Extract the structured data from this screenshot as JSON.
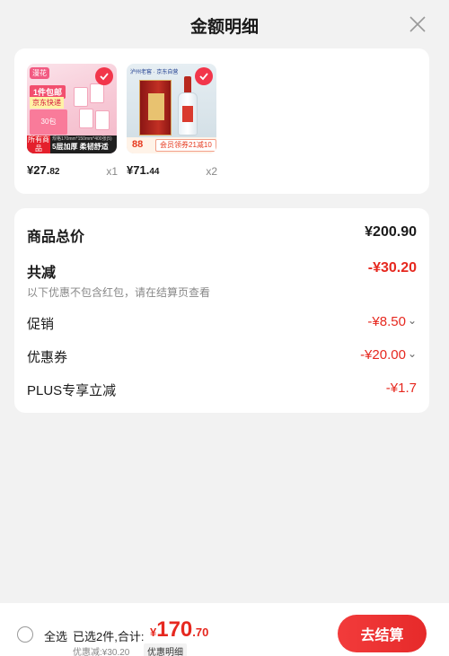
{
  "header": {
    "title": "金额明细"
  },
  "products": [
    {
      "price_main": "¥27.",
      "price_cents": "82",
      "quantity": "x1",
      "image_text": {
        "badge_top": "漫花",
        "promo_a": "1件包邮",
        "promo_b": "京东快递",
        "promo_c": "30包",
        "strip_left_1": "所有商品",
        "strip_left_2": "包邮",
        "strip_main": "5层加厚 柔韧舒适",
        "strip_tiny": "规格170mm*150mm*400张(5)"
      }
    },
    {
      "price_main": "¥71.",
      "price_cents": "44",
      "quantity": "x2",
      "image_text": {
        "logo": "泸州老窖 · 京东自营",
        "num": "88",
        "coupon": "会员领券21减10"
      }
    }
  ],
  "summary": {
    "total_label": "商品总价",
    "total_value": "¥200.90",
    "reduce_label": "共减",
    "reduce_value": "-¥30.20",
    "note": "以下优惠不包含红包，请在结算页查看",
    "promo_label": "促销",
    "promo_value": "-¥8.50",
    "coupon_label": "优惠券",
    "coupon_value": "-¥20.00",
    "plus_label": "PLUS专享立减",
    "plus_value": "-¥1.7"
  },
  "footer": {
    "select_all": "全选",
    "selected_info": "已选2件,合计:",
    "currency": "¥",
    "total_int": "170",
    "total_dec": ".70",
    "discount_text": "优惠减:¥30.20",
    "detail_label": "优惠明细",
    "checkout_label": "去结算"
  },
  "colors": {
    "accent": "#e6281f",
    "check": "#f2364b"
  }
}
